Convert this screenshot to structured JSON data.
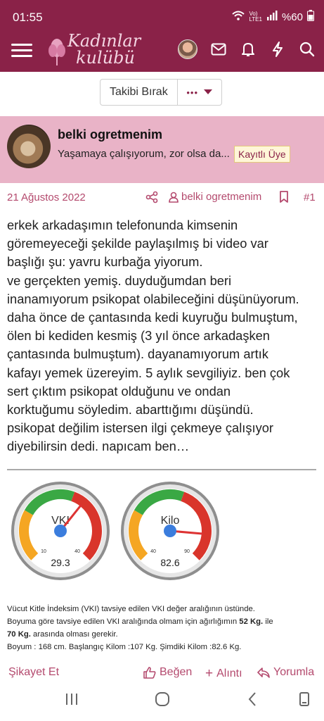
{
  "status_bar": {
    "time": "01:55",
    "battery": "%60"
  },
  "header": {
    "logo_line1": "Kadınlar",
    "logo_line2": "kulübü",
    "icons": [
      "menu-icon",
      "avatar",
      "mail-icon",
      "bell-icon",
      "lightning-icon",
      "search-icon"
    ]
  },
  "follow": {
    "unfollow_label": "Takibi Bırak",
    "more_label": "•••"
  },
  "user": {
    "name": "belki ogretmenim",
    "title": "Yaşamaya çalışıyorum, zor olsa da...",
    "badge": "Kayıtlı Üye"
  },
  "post_meta": {
    "date": "21 Ağustos 2022",
    "author": "belki ogretmenim",
    "number": "#1"
  },
  "post": {
    "lines": [
      "erkek arkadaşımın telefonunda kimsenin",
      "göremeyeceği şekilde paylaşılmış bi video var",
      "başlığı şu: yavru kurbağa yiyorum.",
      "ve gerçekten yemiş. duyduğumdan beri",
      "inanamıyorum psikopat olabileceğini düşünüyorum.",
      "daha önce de çantasında kedi kuyruğu bulmuştum,",
      "ölen bi kediden kesmiş (3 yıl önce arkadaşken",
      "çantasında bulmuştum). dayanamıyorum artık",
      "kafayı yemek üzereyim. 5 aylık sevgiliyiz. ben çok",
      "sert çıktım psikopat olduğunu ve ondan",
      "korktuğumu söyledim. abarttığımı düşündü.",
      "psikopat değilim istersen ilgi çekmeye çalışıyor",
      "diyebilirsin dedi. napıcam ben…"
    ]
  },
  "gauges": [
    {
      "label": "VKI",
      "value": "29.3",
      "min_label": "10",
      "max_label": "40",
      "min": 10,
      "max": 40,
      "reading": 29.3
    },
    {
      "label": "Kilo",
      "value": "82.6",
      "min_label": "40",
      "max_label": "90",
      "min": 40,
      "max": 90,
      "reading": 82.6
    }
  ],
  "signature": {
    "line1": "Vücut Kitle İndeksim (VKI) tavsiye edilen VKI değer aralığının üstünde.",
    "line2a": "Boyuma göre tavsiye edilen VKI aralığında olmam için ağırlığımın ",
    "line2b": "52 Kg.",
    "line2c": " ile",
    "line3a": "70 Kg.",
    "line3b": " arasında olması gerekir.",
    "line4": "Boyum : 168 cm. Başlangıç Kilom :107 Kg. Şimdiki Kilom :82.6 Kg."
  },
  "actions": {
    "report": "Şikayet Et",
    "like": "Beğen",
    "quote": "Alıntı",
    "reply": "Yorumla"
  },
  "colors": {
    "brand": "#8a2248",
    "user_bar": "#e9b3c7",
    "link": "#b44a6e"
  }
}
